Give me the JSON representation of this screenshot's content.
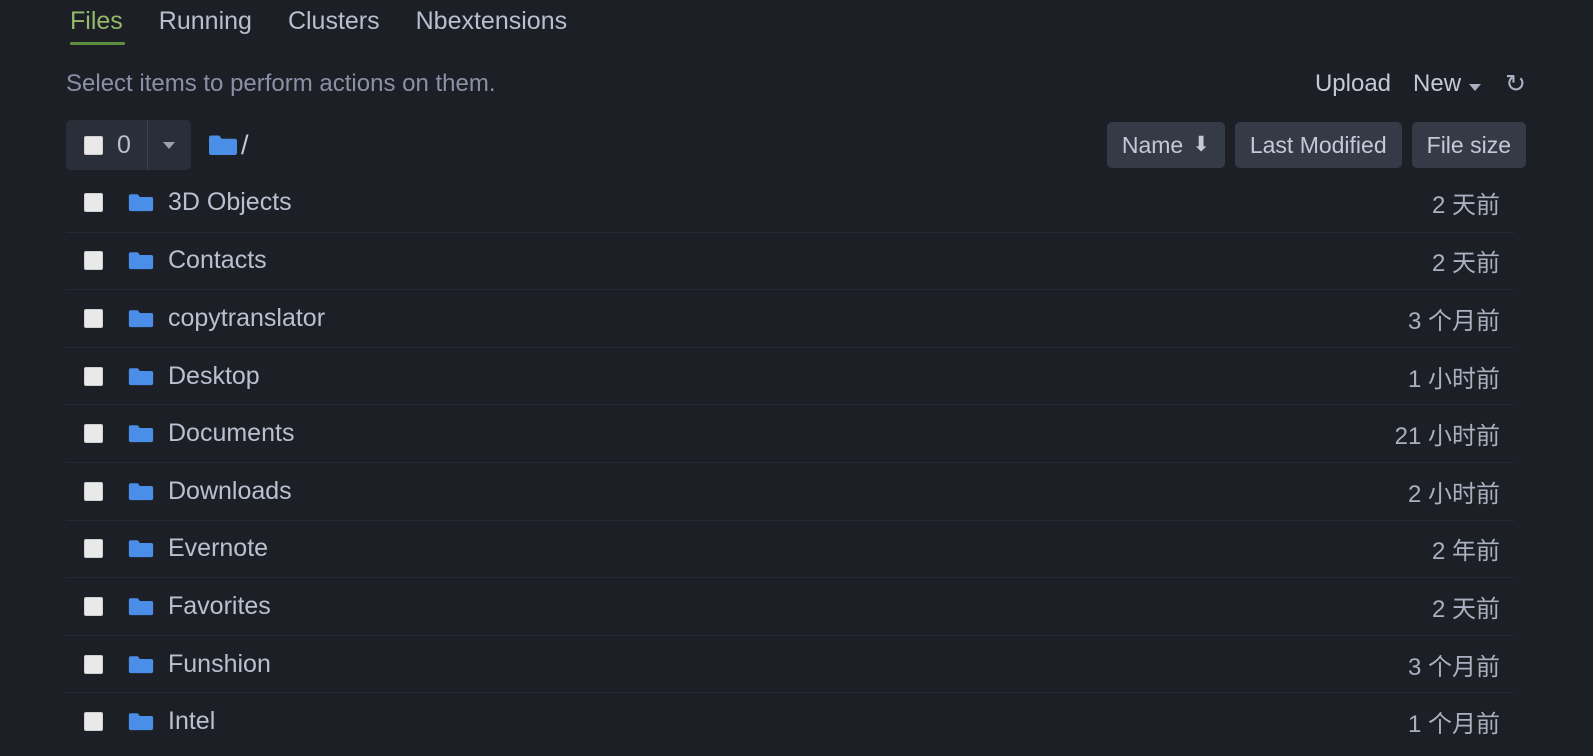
{
  "tabs": [
    {
      "label": "Files",
      "active": true
    },
    {
      "label": "Running",
      "active": false
    },
    {
      "label": "Clusters",
      "active": false
    },
    {
      "label": "Nbextensions",
      "active": false
    }
  ],
  "notice": {
    "text": "Select items to perform actions on them."
  },
  "actions": {
    "upload_label": "Upload",
    "new_label": "New",
    "refresh_icon": "refresh-icon",
    "refresh_glyph": "↻"
  },
  "toolbar": {
    "selected_count": "0",
    "checkbox_icon": "checkbox-unchecked-icon",
    "dropdown_icon": "chevron-down-icon",
    "breadcrumb": {
      "folder_icon": "folder-icon",
      "path_label": "/"
    },
    "sort_buttons": [
      {
        "label": "Name",
        "arrow": "⬇",
        "has_arrow": true
      },
      {
        "label": "Last Modified",
        "arrow": "",
        "has_arrow": false
      },
      {
        "label": "File size",
        "arrow": "",
        "has_arrow": false
      }
    ]
  },
  "files": [
    {
      "name": "3D Objects",
      "icon": "folder-icon",
      "modified": "2 天前"
    },
    {
      "name": "Contacts",
      "icon": "folder-icon",
      "modified": "2 天前"
    },
    {
      "name": "copytranslator",
      "icon": "folder-icon",
      "modified": "3 个月前"
    },
    {
      "name": "Desktop",
      "icon": "folder-icon",
      "modified": "1 小时前"
    },
    {
      "name": "Documents",
      "icon": "folder-icon",
      "modified": "21 小时前"
    },
    {
      "name": "Downloads",
      "icon": "folder-icon",
      "modified": "2 小时前"
    },
    {
      "name": "Evernote",
      "icon": "folder-icon",
      "modified": "2 年前"
    },
    {
      "name": "Favorites",
      "icon": "folder-icon",
      "modified": "2 天前"
    },
    {
      "name": "Funshion",
      "icon": "folder-icon",
      "modified": "3 个月前"
    },
    {
      "name": "Intel",
      "icon": "folder-icon",
      "modified": "1 个月前"
    }
  ],
  "colors": {
    "background": "#1d1f26",
    "folder_blue": "#4a8ee8",
    "active_tab_green": "#93b96b",
    "tab_underline": "#5f8f3c",
    "text_primary": "#b9c0cf",
    "text_muted": "#8c90a6",
    "button_bg": "#353a47",
    "group_bg": "#2a2e38",
    "row_divider": "#262a33"
  }
}
